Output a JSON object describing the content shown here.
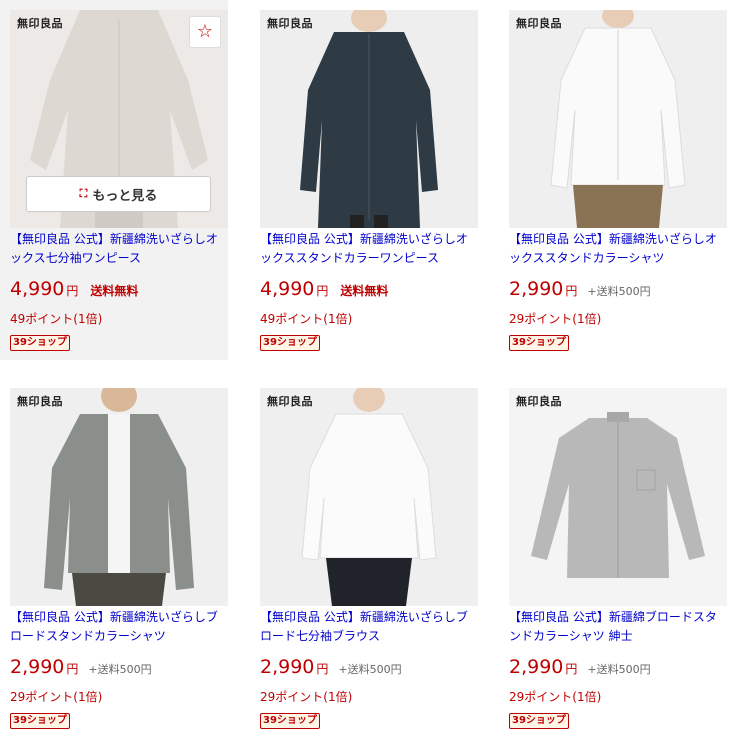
{
  "colors": {
    "price_red": "#bf0000",
    "title_blue": "#0000cc",
    "badge_bg": "#fff6e8"
  },
  "controls": {
    "favorite_icon": "☆",
    "more_button_label": "もっと見る",
    "expand_icon": "⛶"
  },
  "products": [
    {
      "brand": "無印良品",
      "title": "【無印良品 公式】新疆綿洗いざらしオックス七分袖ワンピース",
      "price": "4,990",
      "currency": "円",
      "shipping": "送料無料",
      "points": "49ポイント(1倍)",
      "badge": "39ショップ",
      "garment": "dress",
      "garment_color": "#ddd8d2"
    },
    {
      "brand": "無印良品",
      "title": "【無印良品 公式】新疆綿洗いざらしオックススタンドカラーワンピース",
      "price": "4,990",
      "currency": "円",
      "shipping": "送料無料",
      "points": "49ポイント(1倍)",
      "badge": "39ショップ",
      "garment": "dress",
      "garment_color": "#2e3a44"
    },
    {
      "brand": "無印良品",
      "title": "【無印良品 公式】新疆綿洗いざらしオックススタンドカラーシャツ",
      "price": "2,990",
      "currency": "円",
      "shipping": "+送料500円",
      "points": "29ポイント(1倍)",
      "badge": "39ショップ",
      "garment": "shirt-women",
      "garment_color": "#fafafa"
    },
    {
      "brand": "無印良品",
      "title": "【無印良品 公式】新疆綿洗いざらしブロードスタンドカラーシャツ",
      "price": "2,990",
      "currency": "円",
      "shipping": "+送料500円",
      "points": "29ポイント(1倍)",
      "badge": "39ショップ",
      "garment": "shirt-men",
      "garment_color": "#8b8f8c"
    },
    {
      "brand": "無印良品",
      "title": "【無印良品 公式】新疆綿洗いざらしブロード七分袖ブラウス",
      "price": "2,990",
      "currency": "円",
      "shipping": "+送料500円",
      "points": "29ポイント(1倍)",
      "badge": "39ショップ",
      "garment": "blouse",
      "garment_color": "#fbfbfb"
    },
    {
      "brand": "無印良品",
      "title": "【無印良品 公式】新疆綿ブロードスタンドカラーシャツ 紳士",
      "price": "2,990",
      "currency": "円",
      "shipping": "+送料500円",
      "points": "29ポイント(1倍)",
      "badge": "39ショップ",
      "garment": "flat-shirt",
      "garment_color": "#b8b8b8"
    }
  ]
}
